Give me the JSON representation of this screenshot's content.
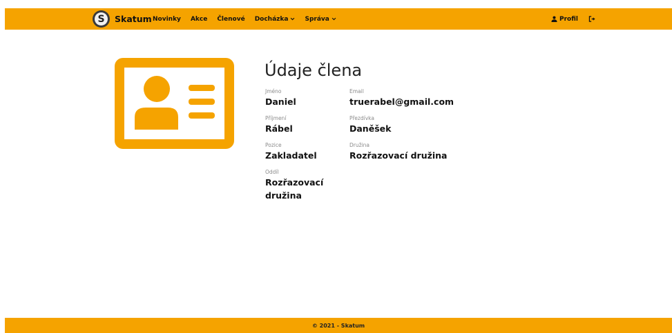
{
  "navbar": {
    "brand_logo_letter": "S",
    "brand_name": "Skatum",
    "items": [
      {
        "label": "Novinky"
      },
      {
        "label": "Akce"
      },
      {
        "label": "Členové"
      },
      {
        "label": "Docházka"
      },
      {
        "label": "Správa"
      }
    ],
    "profile_label": "Profil"
  },
  "member": {
    "title": "Údaje člena",
    "first_name": {
      "label": "Jméno",
      "value": "Daniel"
    },
    "email": {
      "label": "Email",
      "value": "truerabel@gmail.com"
    },
    "last_name": {
      "label": "Příjmení",
      "value": "Rábel"
    },
    "nickname": {
      "label": "Přezdívka",
      "value": "Daněšek"
    },
    "position": {
      "label": "Pozice",
      "value": "Zakladatel"
    },
    "squad": {
      "label": "Družina",
      "value": "Rozřazovací družina"
    },
    "unit": {
      "label": "Oddíl",
      "value": "Rozřazovací družina"
    }
  },
  "footer": {
    "text": "© 2021 - Skatum"
  },
  "colors": {
    "accent": "#f5a300"
  }
}
